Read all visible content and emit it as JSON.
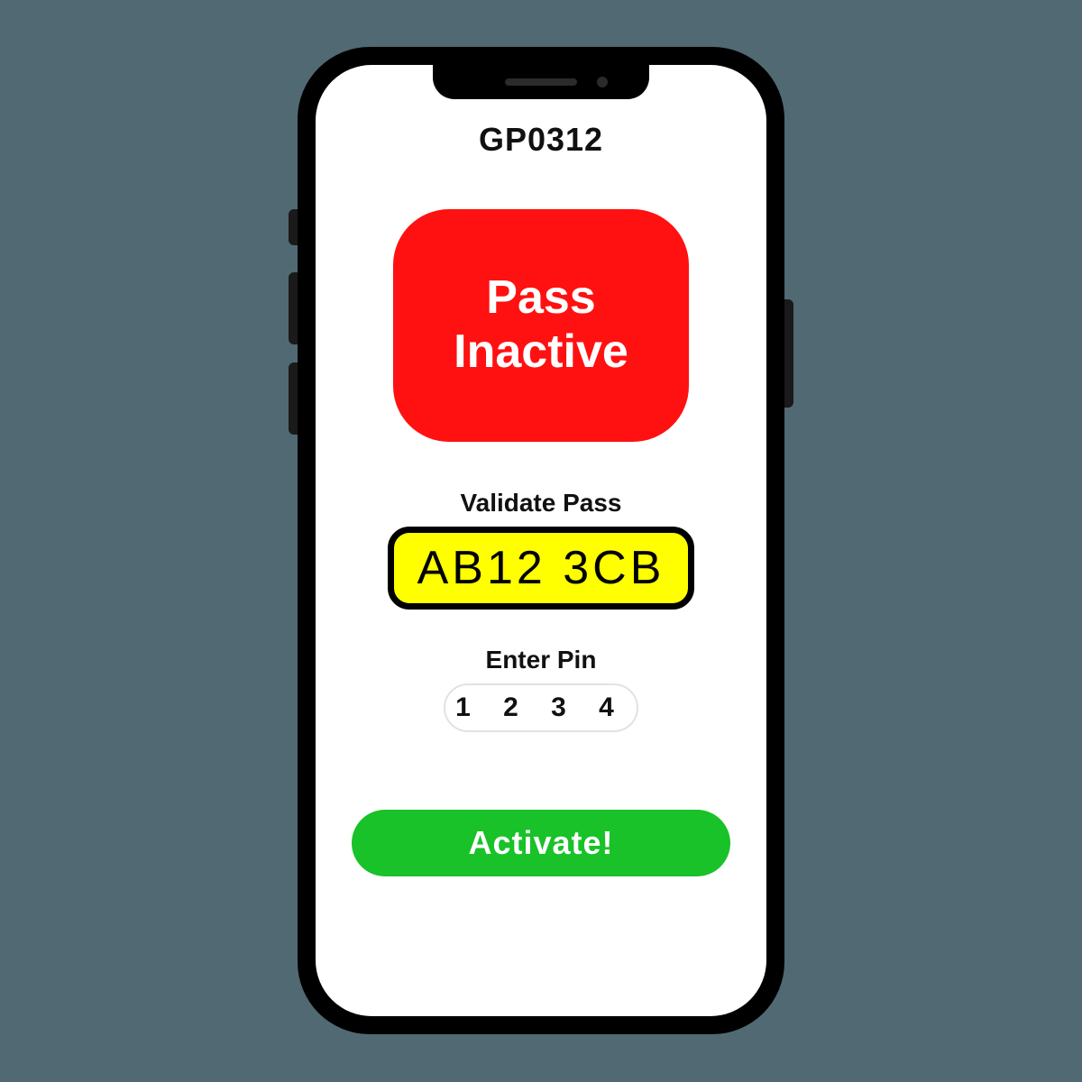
{
  "header": {
    "pass_code": "GP0312"
  },
  "status": {
    "text": "Pass\nInactive",
    "color": "#ff1111"
  },
  "validate": {
    "label": "Validate Pass",
    "plate_value": "AB12 3CB"
  },
  "pin": {
    "label": "Enter Pin",
    "value": "1234"
  },
  "actions": {
    "activate_label": "Activate!"
  },
  "colors": {
    "status_bg": "#ff1111",
    "plate_bg": "#ffff00",
    "activate_bg": "#18c228"
  }
}
